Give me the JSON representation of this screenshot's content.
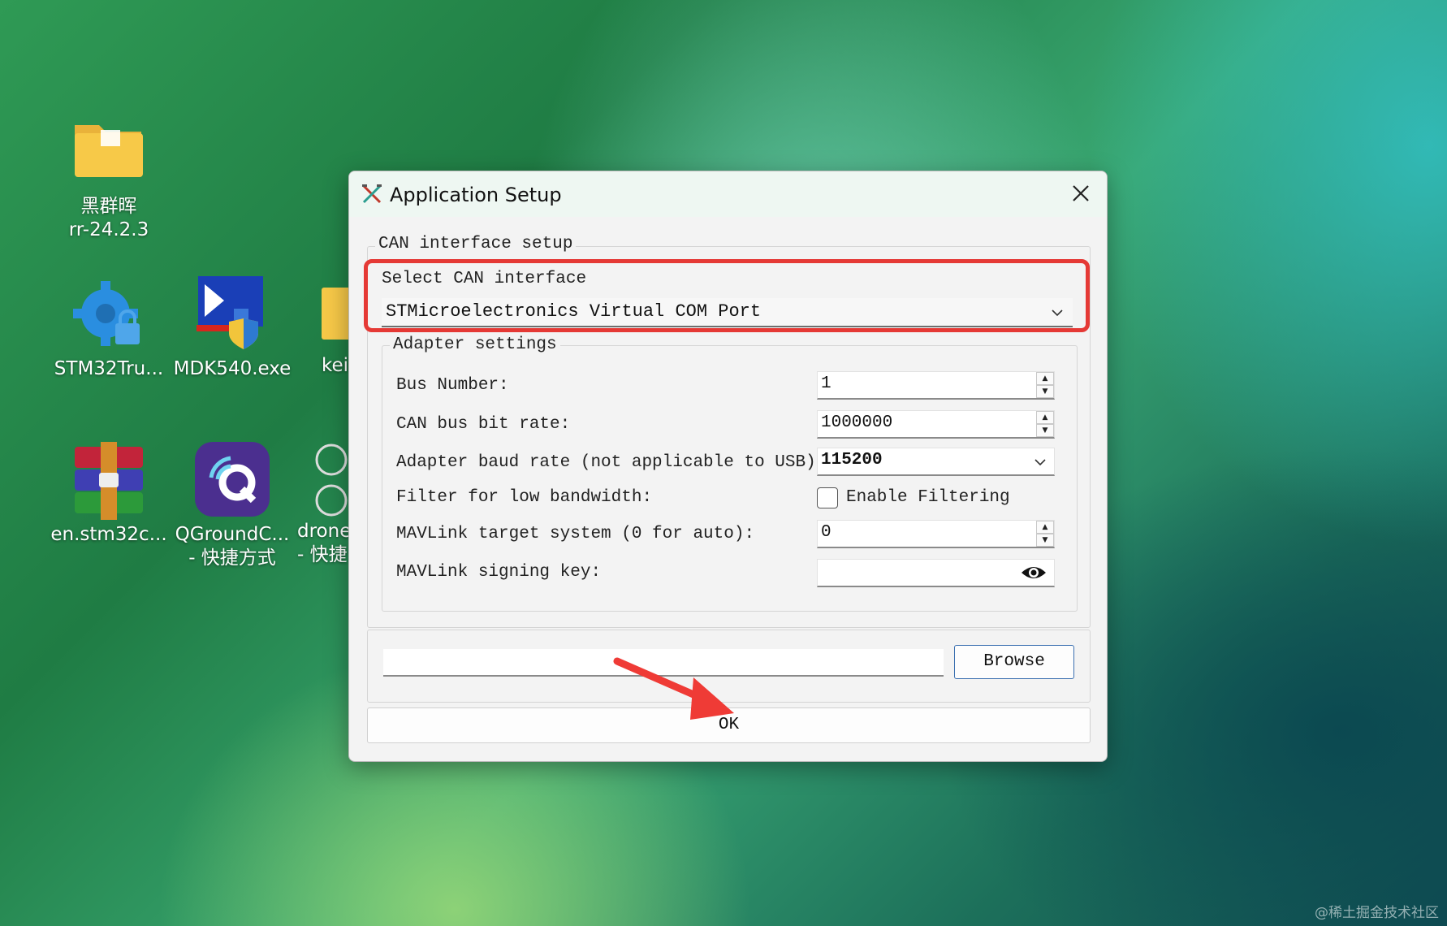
{
  "desktop": {
    "icons": [
      {
        "label_line1": "黑群晖",
        "label_line2": "rr-24.2.3",
        "icon": "folder-icon"
      },
      {
        "label_line1": "STM32Tru...",
        "label_line2": "",
        "icon": "gear-lock-icon"
      },
      {
        "label_line1": "MDK540.exe",
        "label_line2": "",
        "icon": "installer-icon"
      },
      {
        "label_line1": "kei",
        "label_line2": "",
        "icon": "folder-icon"
      },
      {
        "label_line1": "en.stm32c...",
        "label_line2": "",
        "icon": "winrar-archive-icon"
      },
      {
        "label_line1": "QGroundC...",
        "label_line2": "- 快捷方式",
        "icon": "qgroundcontrol-icon"
      },
      {
        "label_line1": "drone",
        "label_line2": "- 快捷",
        "icon": "shortcut-icon"
      }
    ],
    "watermark": "@稀土掘金技术社区"
  },
  "dialog": {
    "title": "Application Setup",
    "can_group_title": "CAN interface setup",
    "select_label": "Select CAN interface",
    "select_value": "STMicroelectronics Virtual COM Port",
    "adapter_group_title": "Adapter settings",
    "bus_number_label": "Bus Number:",
    "bus_number_value": "1",
    "bitrate_label": "CAN bus bit rate:",
    "bitrate_value": "1000000",
    "baud_label": "Adapter baud rate (not applicable to USB):",
    "baud_value": "115200",
    "filter_label": "Filter for low bandwidth:",
    "filter_checkbox_label": "Enable Filtering",
    "filter_checked": false,
    "mav_target_label": "MAVLink target system (0 for auto):",
    "mav_target_value": "0",
    "signing_key_label": "MAVLink signing key:",
    "signing_key_value": "",
    "file_path_value": "",
    "browse_label": "Browse",
    "ok_label": "OK"
  },
  "colors": {
    "highlight": "#e53935",
    "arrow": "#ef3b36"
  }
}
